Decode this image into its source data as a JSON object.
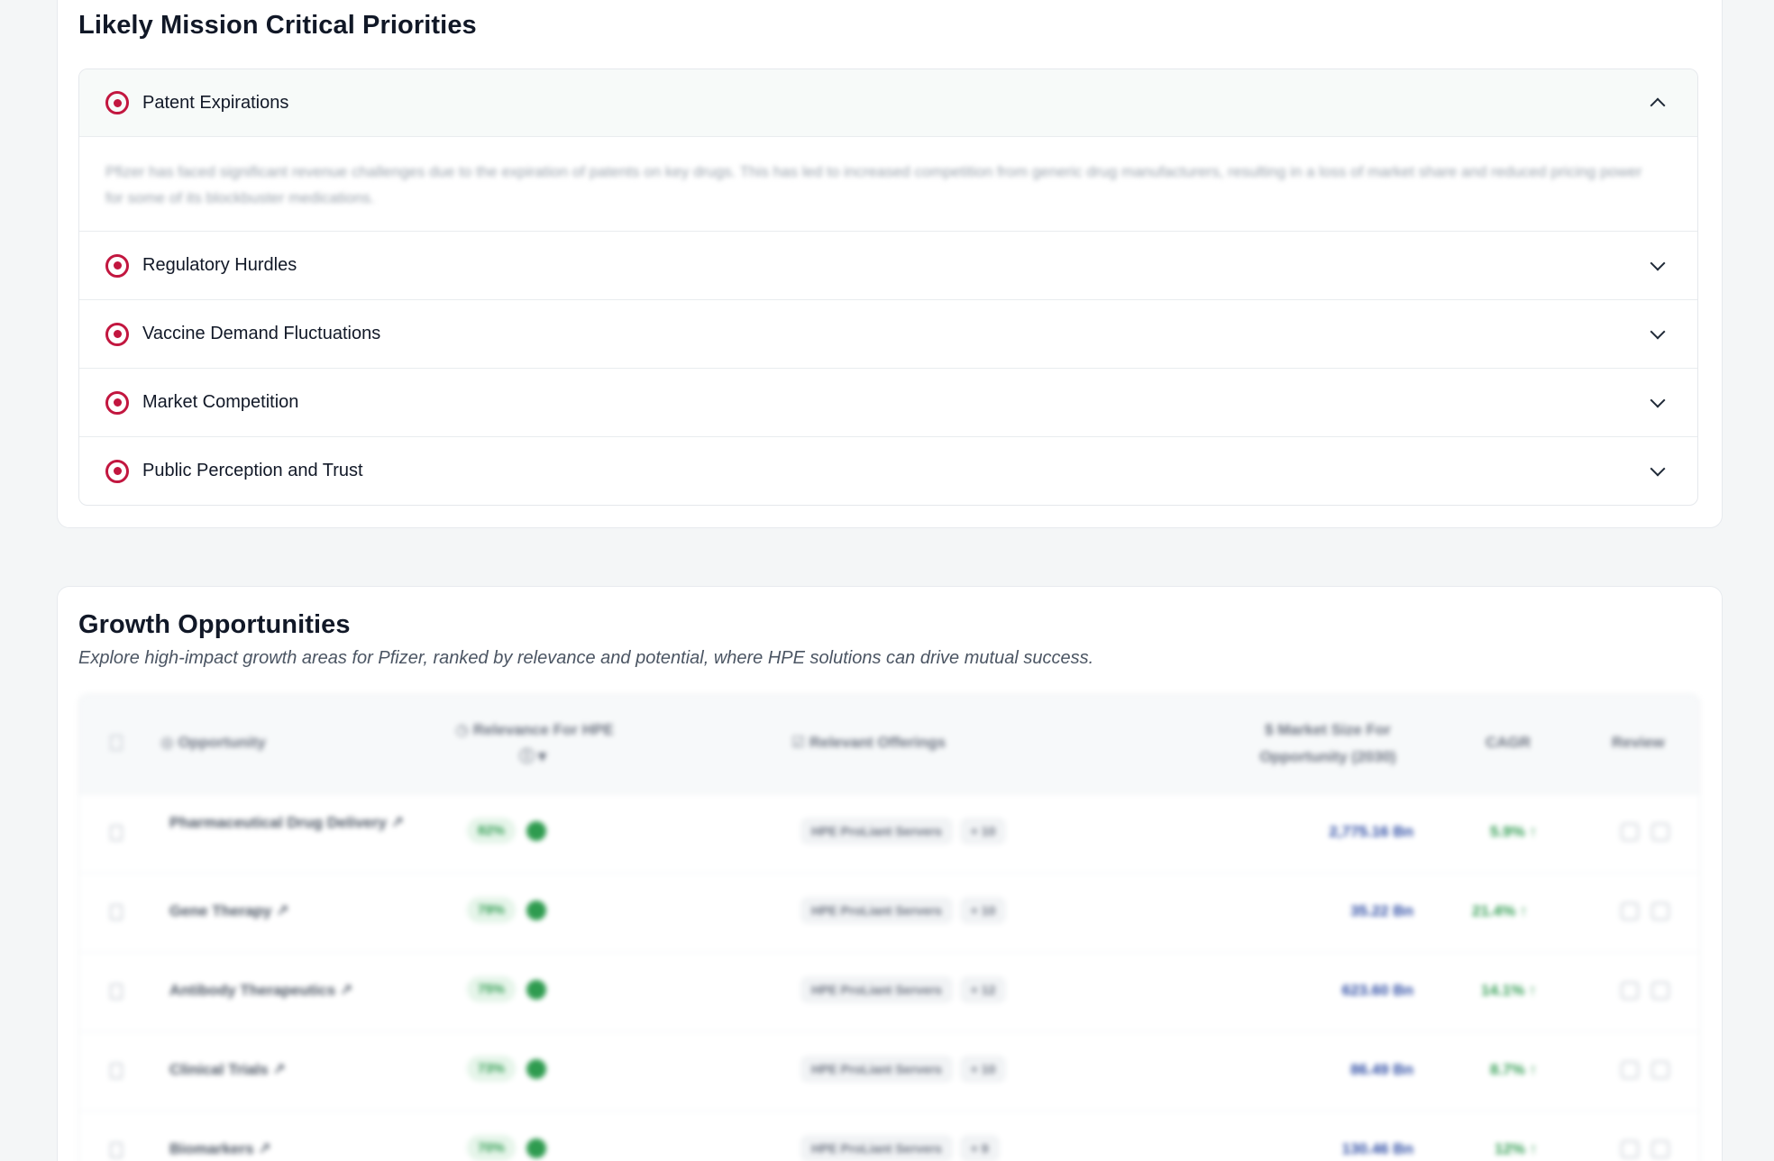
{
  "mission": {
    "title": "Likely Mission Critical Priorities",
    "items": [
      {
        "label": "Patent Expirations",
        "expanded": true,
        "description": "Pfizer has faced significant revenue challenges due to the expiration of patents on key drugs. This has led to increased competition from generic drug manufacturers, resulting in a loss of market share and reduced pricing power for some of its blockbuster medications."
      },
      {
        "label": "Regulatory Hurdles",
        "expanded": false
      },
      {
        "label": "Vaccine Demand Fluctuations",
        "expanded": false
      },
      {
        "label": "Market Competition",
        "expanded": false
      },
      {
        "label": "Public Perception and Trust",
        "expanded": false
      }
    ]
  },
  "growth": {
    "title": "Growth Opportunities",
    "subtitle": "Explore high-impact growth areas for Pfizer, ranked by relevance and potential, where HPE solutions can drive mutual success.",
    "columns": {
      "opportunity": "Opportunity",
      "relevance": "Relevance For HPE",
      "offerings": "Relevant Offerings",
      "market": "Market Size For Opportunity (2030)",
      "cagr": "CAGR",
      "review": "Review"
    },
    "rows": [
      {
        "name": "Pharmaceutical Drug Delivery",
        "relevance": "82%",
        "offering": "HPE ProLiant Servers",
        "more": "+ 10",
        "market": "2,775.16 Bn",
        "cagr": "5.9%"
      },
      {
        "name": "Gene Therapy",
        "relevance": "79%",
        "offering": "HPE ProLiant Servers",
        "more": "+ 10",
        "market": "35.22 Bn",
        "cagr": "21.4%"
      },
      {
        "name": "Antibody Therapeutics",
        "relevance": "75%",
        "offering": "HPE ProLiant Servers",
        "more": "+ 12",
        "market": "623.60 Bn",
        "cagr": "14.1%"
      },
      {
        "name": "Clinical Trials",
        "relevance": "73%",
        "offering": "HPE ProLiant Servers",
        "more": "+ 10",
        "market": "86.49 Bn",
        "cagr": "8.7%"
      },
      {
        "name": "Biomarkers",
        "relevance": "70%",
        "offering": "HPE ProLiant Servers",
        "more": "+ 9",
        "market": "130.46 Bn",
        "cagr": "12%"
      }
    ]
  },
  "colors": {
    "accent_red": "#c2163f",
    "positive_green": "#2e9b4f",
    "market_blue": "#2b4aa3"
  }
}
